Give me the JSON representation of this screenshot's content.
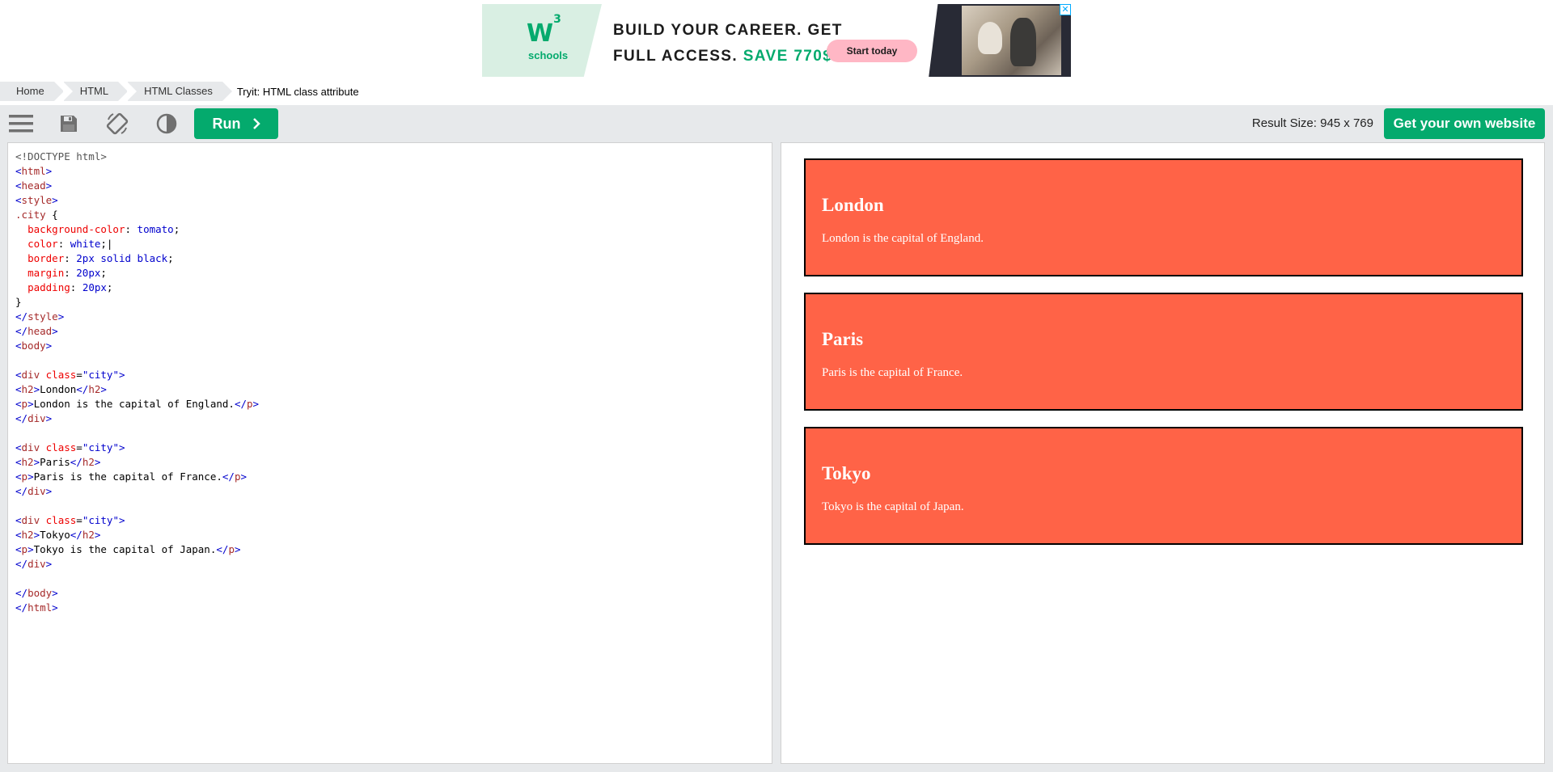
{
  "ad": {
    "logo_mark": "W",
    "logo_sup": "3",
    "logo_text": "schools",
    "headline_line1": "BUILD YOUR CAREER. GET",
    "headline_line2": "FULL ACCESS.",
    "headline_accent": "SAVE 770$",
    "cta_label": "Start today",
    "close_label": "✕",
    "colors": {
      "brand_green": "#04aa6d",
      "cta_pink": "#ffb7c5",
      "logo_bg": "#d9efe3"
    }
  },
  "breadcrumb": {
    "items": [
      "Home",
      "HTML",
      "HTML Classes"
    ],
    "current": "Tryit: HTML class attribute"
  },
  "toolbar": {
    "menu_icon": "menu-icon",
    "save_icon": "save-icon",
    "rotate_icon": "rotate-icon",
    "theme_icon": "contrast-icon",
    "run_label": "Run",
    "result_size": "Result Size: 945 x 769",
    "get_website_label": "Get your own website"
  },
  "cities": [
    {
      "heading": "London",
      "text": "London is the capital of England."
    },
    {
      "heading": "Paris",
      "text": "Paris is the capital of France."
    },
    {
      "heading": "Tokyo",
      "text": "Tokyo is the capital of Japan."
    }
  ]
}
